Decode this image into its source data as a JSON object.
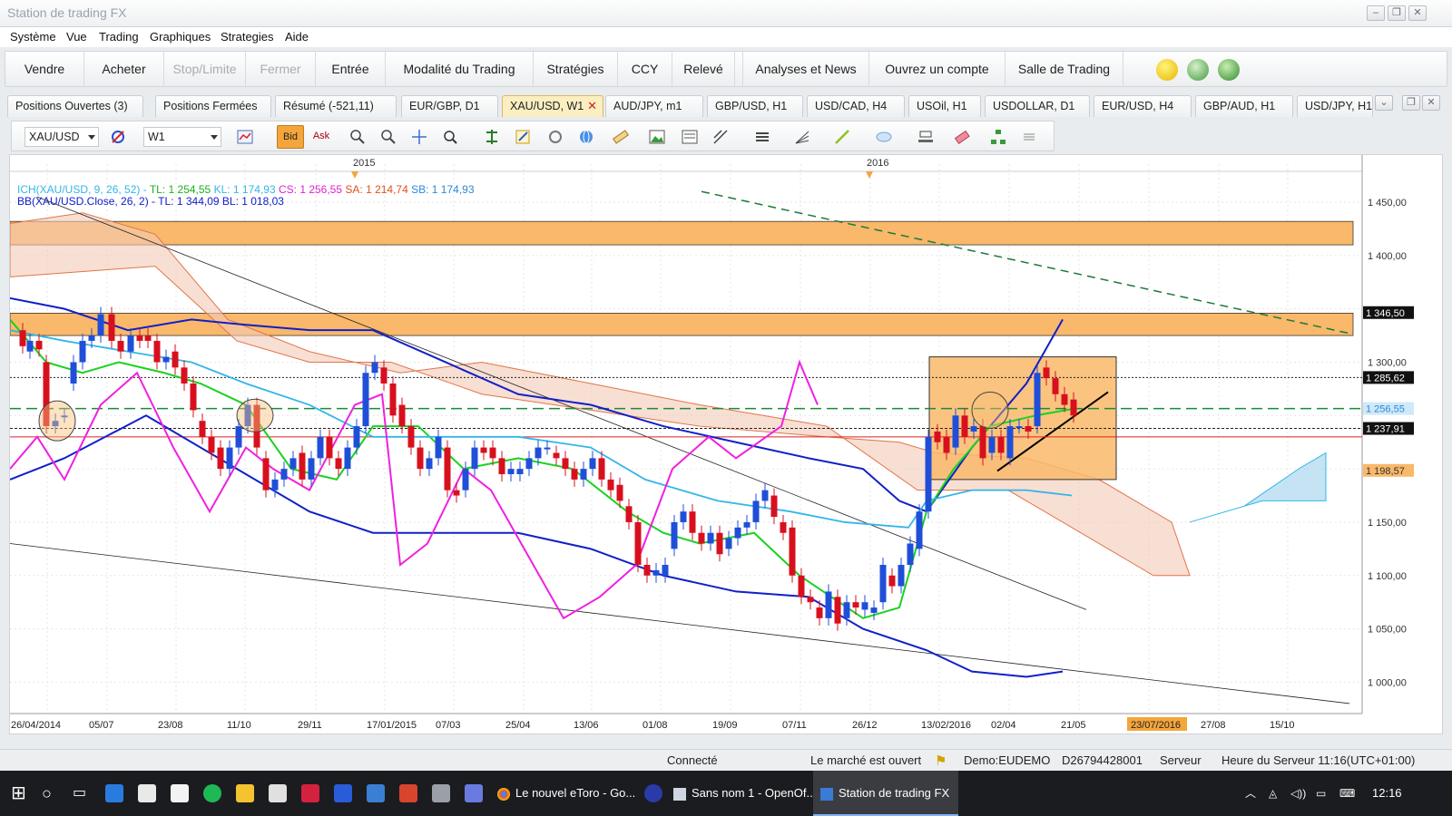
{
  "window": {
    "title": "Station de trading FX"
  },
  "menu": [
    "Système",
    "Vue",
    "Trading",
    "Graphiques",
    "Strategies",
    "Aide"
  ],
  "main_toolbar": {
    "sell": "Vendre",
    "buy": "Acheter",
    "stop_limit": "Stop/Limite",
    "close": "Fermer",
    "entry": "Entrée",
    "trading_mode": "Modalité du Trading",
    "strategies": "Stratégies",
    "ccy": "CCY",
    "statement": "Relevé",
    "analysis_news": "Analyses et News",
    "open_account": "Ouvrez un compte",
    "trading_room": "Salle de Trading"
  },
  "tabs": [
    {
      "label": "Positions Ouvertes (3)",
      "active": false
    },
    {
      "label": "Positions Fermées",
      "active": false
    },
    {
      "label": "Résumé (-521,11)",
      "active": false
    },
    {
      "label": "EUR/GBP, D1",
      "active": false
    },
    {
      "label": "XAU/USD, W1",
      "active": true
    },
    {
      "label": "AUD/JPY, m1",
      "active": false
    },
    {
      "label": "GBP/USD, H1",
      "active": false
    },
    {
      "label": "USD/CAD, H4",
      "active": false
    },
    {
      "label": "USOil, H1",
      "active": false
    },
    {
      "label": "USDOLLAR, D1",
      "active": false
    },
    {
      "label": "EUR/USD, H4",
      "active": false
    },
    {
      "label": "GBP/AUD, H1",
      "active": false
    },
    {
      "label": "USD/JPY, H1",
      "active": false
    }
  ],
  "chart_toolbar": {
    "symbol": "XAU/USD",
    "timeframe": "W1",
    "bid": "Bid",
    "ask": "Ask"
  },
  "chart": {
    "year_labels": [
      "2015",
      "2016"
    ],
    "indicator_ichimoku": {
      "name": "ICH(XAU/USD, 9, 26, 52) -",
      "tl": "TL: 1 254,55",
      "kl": "KL: 1 174,93",
      "cs": "CS: 1 256,55",
      "sa": "SA: 1 214,74",
      "sb": "SB: 1 174,93"
    },
    "indicator_bb": {
      "name": "BB(XAU/USD.Close, 26, 2) -",
      "tl": "TL: 1 344,09",
      "bl": "BL: 1 018,03"
    },
    "price_axis": [
      "1 450,00",
      "1 400,00",
      "1 300,00",
      "1 150,00",
      "1 100,00",
      "1 050,00",
      "1 000,00"
    ],
    "price_tags": [
      {
        "value": "1 346,50",
        "style": "dark"
      },
      {
        "value": "1 285,62",
        "style": "dark"
      },
      {
        "value": "1 256,55",
        "style": "blue"
      },
      {
        "value": "1 237,91",
        "style": "dark"
      },
      {
        "value": "1 198,57",
        "style": "orange"
      }
    ],
    "date_axis": [
      "26/04/2014",
      "05/07",
      "23/08",
      "11/10",
      "29/11",
      "17/01/2015",
      "07/03",
      "25/04",
      "13/06",
      "01/08",
      "19/09",
      "07/11",
      "26/12",
      "13/02/2016",
      "02/04",
      "21/05",
      "23/07/2016",
      "27/08",
      "15/10"
    ],
    "colors": {
      "bull": "#1f4fd8",
      "bear": "#d8101e",
      "zone": "#f9b86a",
      "tenkan": "#19d21f",
      "kijun": "#33b6e8",
      "bb": "#1020c8",
      "magenta": "#f020e0"
    }
  },
  "status": {
    "connection": "Connecté",
    "market": "Le marché est ouvert",
    "account": "Demo:EUDEMO",
    "account_id": "D26794428001",
    "server": "Serveur",
    "server_time": "Heure du Serveur 11:16(UTC+01:00)"
  },
  "taskbar": {
    "items": [
      "Le nouvel eToro - Go...",
      "Sans nom 1 - OpenOf...",
      "Station de trading FX"
    ],
    "clock": "12:16"
  }
}
